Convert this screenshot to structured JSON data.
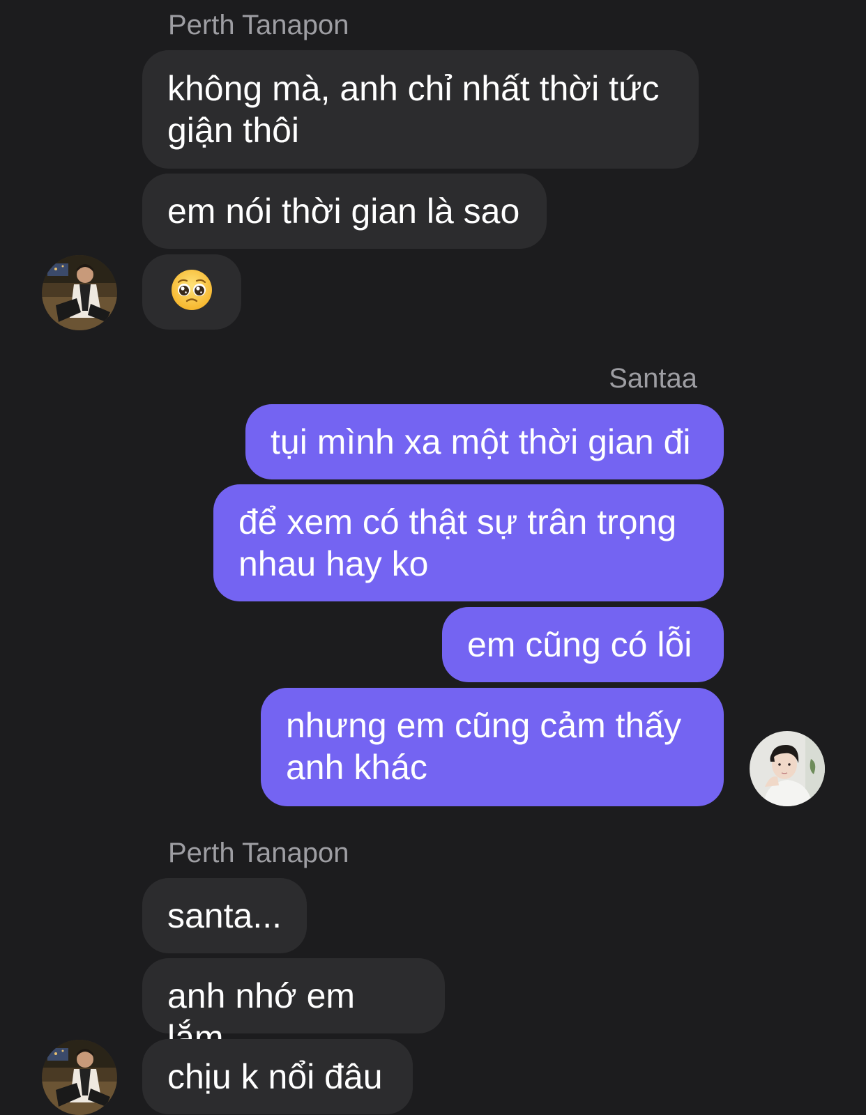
{
  "thread": {
    "first_group": {
      "sender": "Perth Tanapon",
      "messages": [
        "không mà, anh chỉ nhất thời tức giận thôi",
        "em nói thời gian là sao"
      ],
      "emoji_message": "pleading-face-emoji"
    },
    "second_group": {
      "sender": "Santaa",
      "messages": [
        "tụi mình xa một thời gian đi",
        "để xem có thật sự trân trọng nhau hay ko",
        "em cũng có lỗi",
        "nhưng em cũng cảm thấy anh khác"
      ]
    },
    "third_group": {
      "sender": "Perth Tanapon",
      "messages": [
        "santa...",
        "anh nhớ em lắm",
        "chịu k nổi đâu"
      ]
    }
  },
  "colors": {
    "background": "#1c1c1e",
    "incoming_bubble": "#2c2c2e",
    "outgoing_bubble": "#7464f2",
    "sender_name": "#9e9ea3"
  }
}
